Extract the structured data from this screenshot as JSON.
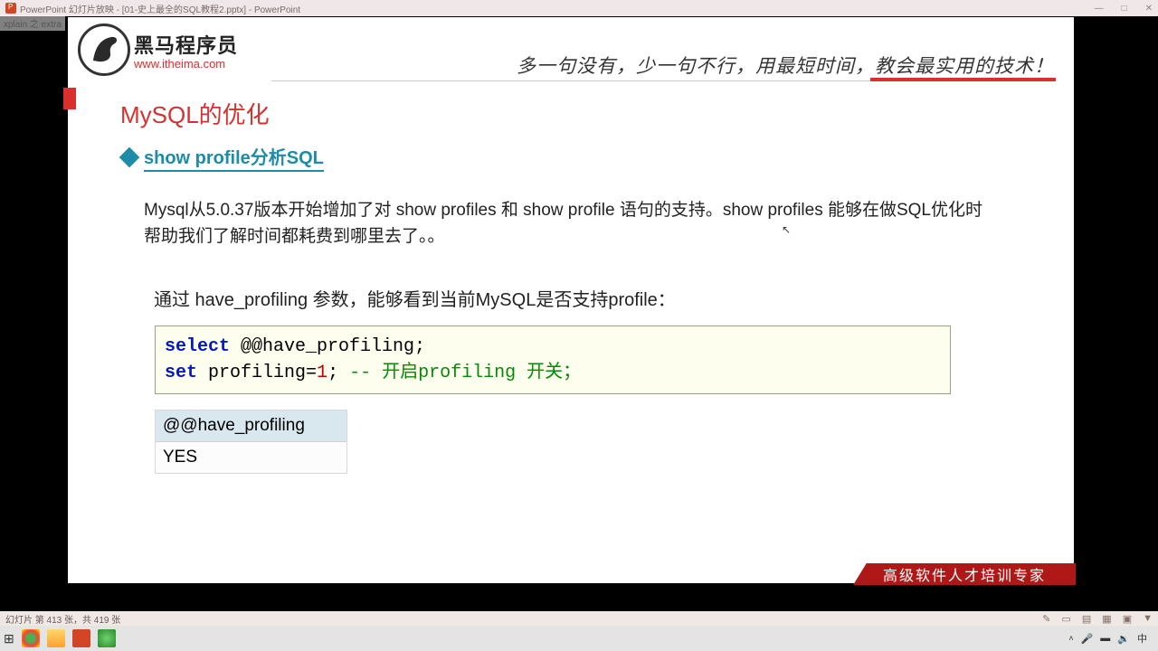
{
  "window": {
    "title": "PowerPoint 幻灯片放映 - [01-史上最全的SQL教程2.pptx] - PowerPoint",
    "minimize": "—",
    "maximize": "□",
    "close": "✕"
  },
  "top_meta": "xplain 之 extra",
  "logo": {
    "cn": "黑马程序员",
    "url": "www.itheima.com"
  },
  "slogan": "多一句没有，少一句不行，用最短时间，教会最实用的技术！",
  "h1": "MySQL的优化",
  "subhead": "show profile分析SQL",
  "para1": "Mysql从5.0.37版本开始增加了对 show profiles 和 show profile 语句的支持。show profiles 能够在做SQL优化时帮助我们了解时间都耗费到哪里去了。。",
  "para2": "通过 have_profiling 参数，能够看到当前MySQL是否支持profile：",
  "code": {
    "kw_select": "select",
    "rest1": " @@have_profiling;",
    "kw_set": "set",
    "rest2": " profiling=",
    "num1": "1",
    "rest3": "; ",
    "comment": "-- 开启profiling 开关；"
  },
  "result": {
    "header": "@@have_profiling",
    "value": "YES"
  },
  "ribbon": "高级软件人才培训专家",
  "status": {
    "left": "幻灯片 第 413 张，共 419 张"
  },
  "taskbar": {
    "time": ""
  }
}
